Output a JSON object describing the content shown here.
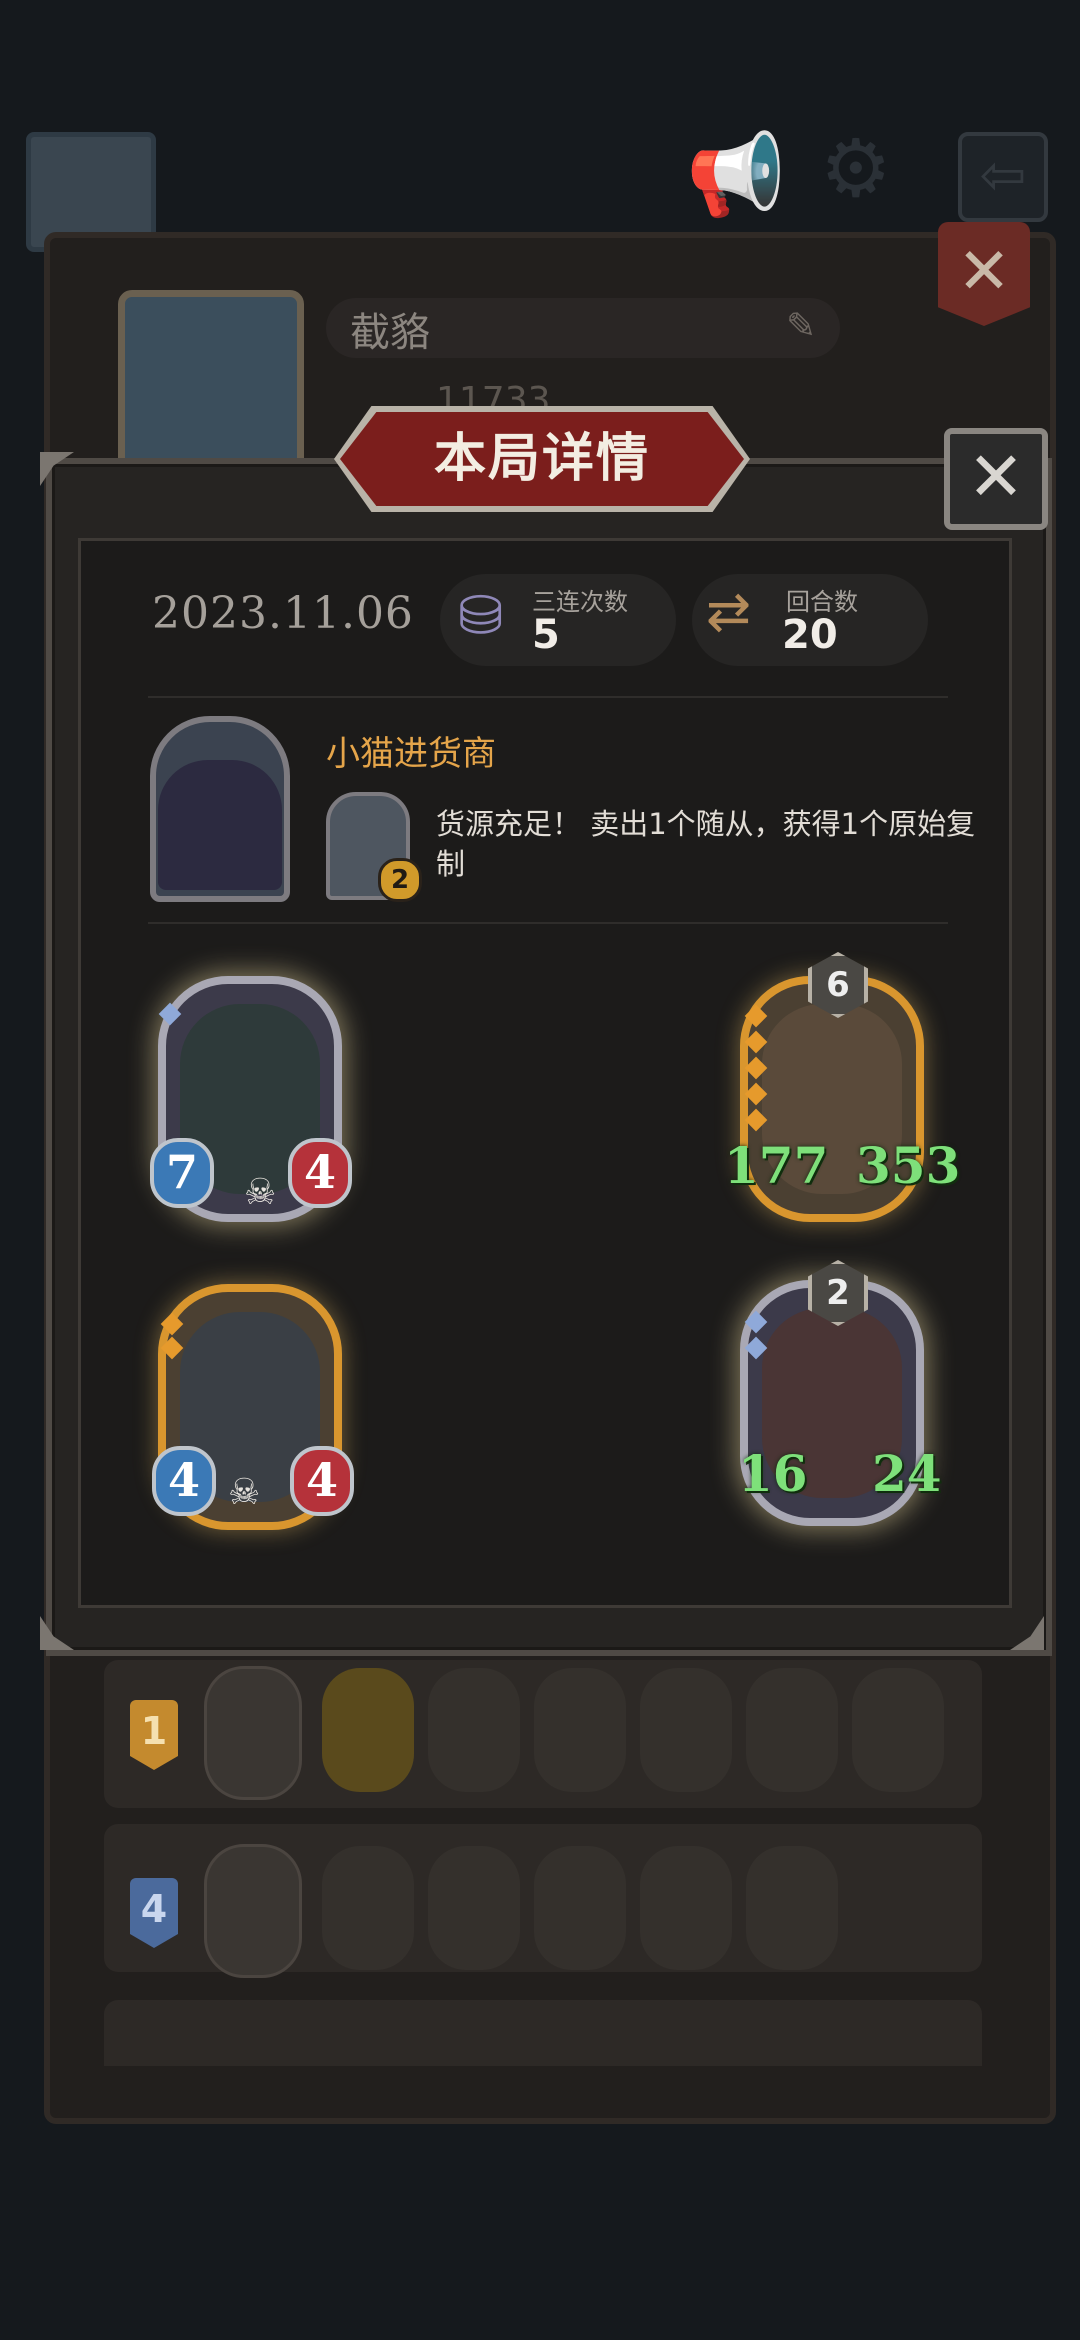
{
  "background": {
    "player_name": "截貉",
    "score": "11733",
    "exit_icon": "exit-arrow-icon",
    "rank_rows": [
      {
        "rank": "1",
        "badge_color": "#c48a2e"
      },
      {
        "rank": "4",
        "badge_color": "#4b6a9c"
      }
    ]
  },
  "modal": {
    "title": "本局详情",
    "close_icon": "close-icon",
    "date": "2023.11.06",
    "stats": {
      "triples_label": "三连次数",
      "triples_value": "5",
      "turns_label": "回合数",
      "turns_value": "20"
    },
    "hero": {
      "name": "小猫进货商",
      "power_cost": "2",
      "power_description": "货源充足！ 卖出1个随从，获得1个原始复制"
    },
    "minions": [
      {
        "slot": "left-top",
        "attack": "7",
        "health": "4",
        "frame": "silver"
      },
      {
        "slot": "right-top",
        "attack": "177",
        "health": "353",
        "tier": "6",
        "frame": "gold"
      },
      {
        "slot": "left-bottom",
        "attack": "4",
        "health": "4",
        "frame": "gold"
      },
      {
        "slot": "right-bottom",
        "attack": "16",
        "health": "24",
        "tier": "2",
        "frame": "silver"
      }
    ]
  }
}
